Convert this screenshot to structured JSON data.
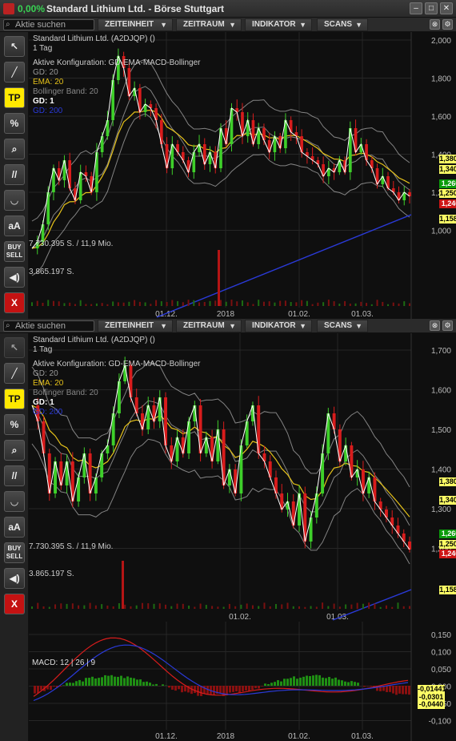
{
  "window": {
    "change_pct": "0,00%",
    "title": "Standard Lithium Ltd. - Börse Stuttgart",
    "buttons": [
      "–",
      "□",
      "✕"
    ]
  },
  "toolbar": {
    "search_placeholder": "Aktie suchen",
    "menus": [
      "ZEITEINHEIT",
      "ZEITRAUM",
      "INDIKATOR",
      "SCANS"
    ]
  },
  "sidebar": {
    "tools": [
      "cursor-tool",
      "line-tool",
      "TP",
      "%",
      "zoom-tool",
      "parallel-tool",
      "arc-tool",
      "aA",
      "BUY SELL",
      "sound-tool",
      "X"
    ]
  },
  "chart1": {
    "name": "Standard Lithium Ltd. (A2DJQP) ()",
    "period": "1 Tag",
    "config": "Aktive Konfiguration: GD-EMA-MACD-Bollinger",
    "gd20": "GD: 20",
    "ema20": "EMA: 20",
    "bb": "Bollinger Band: 20",
    "gd1": "GD: 1",
    "gd200": "GD: 200",
    "vol_max": "7.730.395 S. / 11,9 Mio.",
    "vol_mid": "3.865.197 S.",
    "yticks": [
      "2,000",
      "1,800",
      "1,600",
      "1,400",
      "1,200",
      "1,000"
    ],
    "xticks": [
      "01.12.",
      "2018",
      "01.02.",
      "01.03."
    ],
    "tags": [
      "1,3802",
      "1,3409",
      "1,260",
      "1,2500",
      "1,240",
      "1,1585"
    ]
  },
  "chart2": {
    "name": "Standard Lithium Ltd. (A2DJQP) ()",
    "period": "1 Tag",
    "config": "Aktive Konfiguration: GD-EMA-MACD-Bollinger",
    "gd20": "GD: 20",
    "ema20": "EMA: 20",
    "bb": "Bollinger Band: 20",
    "gd1": "GD: 1",
    "gd200": "GD: 200",
    "vol_max": "7.730.395 S. / 11,9 Mio.",
    "vol_mid": "3.865.197 S.",
    "yticks": [
      "1,700",
      "1,600",
      "1,500",
      "1,400",
      "1,300",
      "1,200"
    ],
    "xticks": [
      "01.02.",
      "01.03."
    ],
    "tags": [
      "1,3802",
      "1,3409",
      "1,260",
      "1,2500",
      "1,240",
      "1,1585"
    ]
  },
  "macd": {
    "label": "MACD: 12 | 26 | 9",
    "yticks": [
      "0,150",
      "0,100",
      "0,050",
      "0,000",
      "-0,050",
      "-0,100"
    ],
    "xticks": [
      "01.12.",
      "2018",
      "01.02.",
      "01.03."
    ],
    "tags": [
      "-0,01441",
      "-0,0301",
      "-0,0440"
    ]
  },
  "colors": {
    "up": "#3ecf2a",
    "down": "#d81c1c",
    "gd20": "#b5b5b5",
    "ema": "#e6c21a",
    "gd200": "#2a3ad8",
    "tag_yellow": "#ffff66",
    "tag_green": "#0a9a0a",
    "tag_red": "#cc1515"
  }
}
